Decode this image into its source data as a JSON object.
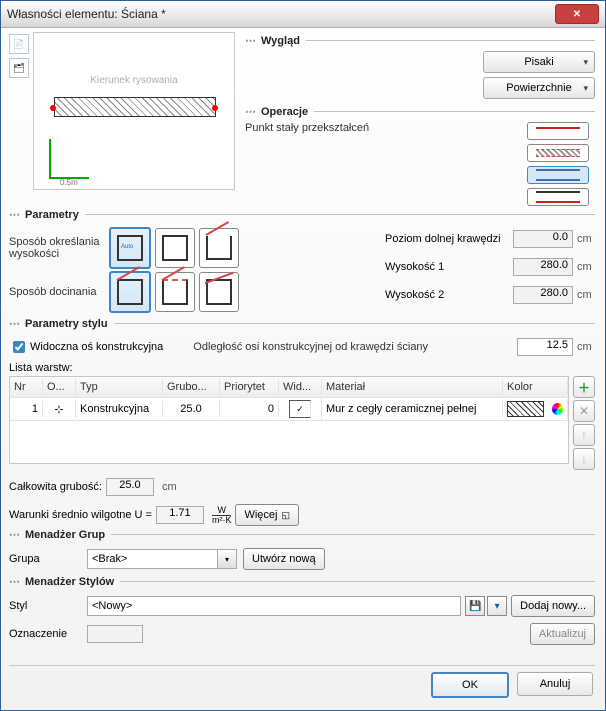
{
  "window": {
    "title": "Własności elementu: Ściana *"
  },
  "preview": {
    "direction_label": "Kierunek rysowania",
    "scale": "0.5m"
  },
  "appearance": {
    "title": "Wygląd",
    "btn_pens": "Pisaki",
    "btn_surfaces": "Powierzchnie"
  },
  "operations": {
    "title": "Operacje",
    "label": "Punkt stały przekształceń"
  },
  "parameters": {
    "title": "Parametry",
    "method_height": "Sposób określania wysokości",
    "method_cut": "Sposób docinania",
    "bottom_level_label": "Poziom dolnej krawędzi",
    "bottom_level_value": "0.0",
    "height1_label": "Wysokość 1",
    "height1_value": "280.0",
    "height2_label": "Wysokość 2",
    "height2_value": "280.0",
    "unit": "cm"
  },
  "style_params": {
    "title": "Parametry stylu",
    "axis_visible": "Widoczna oś konstrukcyjna",
    "axis_visible_checked": true,
    "offset_label": "Odległość osi konstrukcyjnej od krawędzi ściany",
    "offset_value": "12.5",
    "unit": "cm",
    "list_label": "Lista warstw:",
    "columns": {
      "nr": "Nr",
      "o": "O...",
      "type": "Typ",
      "thick": "Grubo...",
      "pri": "Priorytet",
      "wid": "Wid...",
      "mat": "Materiał",
      "col": "Kolor"
    },
    "rows": [
      {
        "nr": "1",
        "o": "⊹",
        "type": "Konstrukcyjna",
        "thick": "25.0",
        "pri": "0",
        "wid": true,
        "mat": "Mur z cegły ceramicznej pełnej"
      }
    ]
  },
  "totals": {
    "total_thickness_label": "Całkowita grubość:",
    "total_thickness_value": "25.0",
    "unit": "cm",
    "humidity_label": "Warunki średnio wilgotne U =",
    "u_value": "1.71",
    "u_unit_top": "W",
    "u_unit_bottom": "m²·K",
    "more_btn": "Więcej"
  },
  "groups": {
    "title": "Menadżer Grup",
    "label": "Grupa",
    "value": "<Brak>",
    "create_btn": "Utwórz nową"
  },
  "styles": {
    "title": "Menadżer Stylów",
    "label": "Styl",
    "value": "<Nowy>",
    "add_btn": "Dodaj nowy...",
    "mark_label": "Oznaczenie",
    "update_btn": "Aktualizuj"
  },
  "footer": {
    "ok": "OK",
    "cancel": "Anuluj"
  }
}
